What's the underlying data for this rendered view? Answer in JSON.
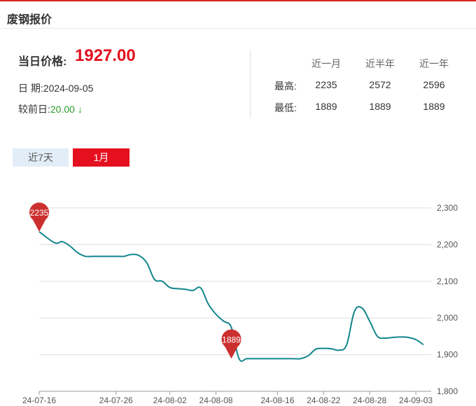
{
  "header": {
    "title": "废钢报价"
  },
  "summary": {
    "price_label": "当日价格:",
    "price_value": "1927.00",
    "date_label": "日 期:",
    "date_value": "2024-09-05",
    "change_label": "较前日:",
    "change_value": "20.00",
    "change_arrow": "↓",
    "change_color": "#2a9d2a",
    "price_color": "#e4101f"
  },
  "stats": {
    "columns": [
      "近一月",
      "近半年",
      "近一年"
    ],
    "rows": [
      {
        "label": "最高:",
        "values": [
          "2235",
          "2572",
          "2596"
        ]
      },
      {
        "label": "最低:",
        "values": [
          "1889",
          "1889",
          "1889"
        ]
      }
    ]
  },
  "tabs": [
    {
      "label": "近7天",
      "active": false
    },
    {
      "label": "1月",
      "active": true
    }
  ],
  "chart_data": {
    "type": "line",
    "title": "",
    "xlabel": "",
    "ylabel": "",
    "ylim": [
      1800,
      2300
    ],
    "yticks": [
      1800,
      1900,
      2000,
      2100,
      2200,
      2300
    ],
    "ytick_labels": [
      "1,800",
      "1,900",
      "2,000",
      "2,100",
      "2,200",
      "2,300"
    ],
    "xtick_labels": [
      "24-07-16",
      "24-07-26",
      "24-08-02",
      "24-08-08",
      "24-08-16",
      "24-08-22",
      "24-08-28",
      "24-09-03"
    ],
    "xtick_positions": [
      0,
      10,
      17,
      23,
      31,
      37,
      43,
      49
    ],
    "line_color": "#13868d",
    "grid": true,
    "series": [
      {
        "x": [
          0,
          2,
          3,
          4,
          5,
          6,
          7,
          8,
          9,
          10,
          11,
          12,
          13,
          14,
          15,
          16,
          17,
          18,
          19,
          20,
          21,
          22,
          23,
          24,
          25,
          26,
          27,
          28,
          29,
          30,
          31,
          32,
          33,
          34,
          35,
          36,
          37,
          38,
          39,
          40,
          41,
          42,
          43,
          44,
          45,
          46,
          47,
          48,
          49,
          50
        ],
        "values": [
          2235,
          2205,
          2208,
          2196,
          2178,
          2168,
          2168,
          2168,
          2168,
          2168,
          2168,
          2173,
          2170,
          2150,
          2105,
          2100,
          2083,
          2080,
          2078,
          2075,
          2082,
          2038,
          2010,
          1991,
          1974,
          1889,
          1889,
          1889,
          1889,
          1889,
          1889,
          1889,
          1889,
          1889,
          1897,
          1915,
          1917,
          1916,
          1912,
          1927,
          2017,
          2027,
          1991,
          1950,
          1945,
          1947,
          1948,
          1947,
          1941,
          1927
        ]
      }
    ],
    "markers": [
      {
        "label": "2235",
        "x": 0,
        "value": 2235,
        "color": "#cc2f2f"
      },
      {
        "label": "1889",
        "x": 25,
        "value": 1889,
        "color": "#cc2f2f"
      }
    ]
  }
}
